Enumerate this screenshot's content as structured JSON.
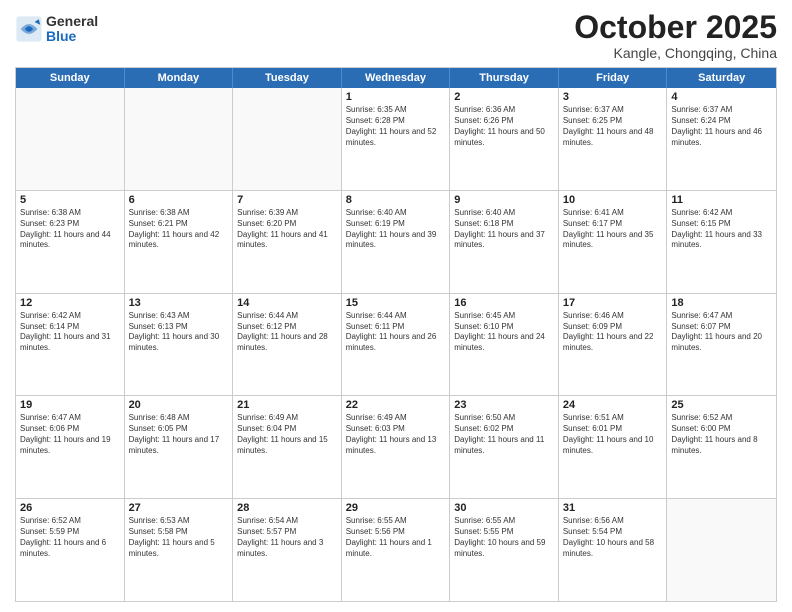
{
  "header": {
    "logo": {
      "general": "General",
      "blue": "Blue"
    },
    "title": "October 2025",
    "subtitle": "Kangle, Chongqing, China"
  },
  "days_of_week": [
    "Sunday",
    "Monday",
    "Tuesday",
    "Wednesday",
    "Thursday",
    "Friday",
    "Saturday"
  ],
  "rows": [
    [
      {
        "day": "",
        "empty": true
      },
      {
        "day": "",
        "empty": true
      },
      {
        "day": "",
        "empty": true
      },
      {
        "day": "1",
        "sunrise": "6:35 AM",
        "sunset": "6:28 PM",
        "daylight": "11 hours and 52 minutes."
      },
      {
        "day": "2",
        "sunrise": "6:36 AM",
        "sunset": "6:26 PM",
        "daylight": "11 hours and 50 minutes."
      },
      {
        "day": "3",
        "sunrise": "6:37 AM",
        "sunset": "6:25 PM",
        "daylight": "11 hours and 48 minutes."
      },
      {
        "day": "4",
        "sunrise": "6:37 AM",
        "sunset": "6:24 PM",
        "daylight": "11 hours and 46 minutes."
      }
    ],
    [
      {
        "day": "5",
        "sunrise": "6:38 AM",
        "sunset": "6:23 PM",
        "daylight": "11 hours and 44 minutes."
      },
      {
        "day": "6",
        "sunrise": "6:38 AM",
        "sunset": "6:21 PM",
        "daylight": "11 hours and 42 minutes."
      },
      {
        "day": "7",
        "sunrise": "6:39 AM",
        "sunset": "6:20 PM",
        "daylight": "11 hours and 41 minutes."
      },
      {
        "day": "8",
        "sunrise": "6:40 AM",
        "sunset": "6:19 PM",
        "daylight": "11 hours and 39 minutes."
      },
      {
        "day": "9",
        "sunrise": "6:40 AM",
        "sunset": "6:18 PM",
        "daylight": "11 hours and 37 minutes."
      },
      {
        "day": "10",
        "sunrise": "6:41 AM",
        "sunset": "6:17 PM",
        "daylight": "11 hours and 35 minutes."
      },
      {
        "day": "11",
        "sunrise": "6:42 AM",
        "sunset": "6:15 PM",
        "daylight": "11 hours and 33 minutes."
      }
    ],
    [
      {
        "day": "12",
        "sunrise": "6:42 AM",
        "sunset": "6:14 PM",
        "daylight": "11 hours and 31 minutes."
      },
      {
        "day": "13",
        "sunrise": "6:43 AM",
        "sunset": "6:13 PM",
        "daylight": "11 hours and 30 minutes."
      },
      {
        "day": "14",
        "sunrise": "6:44 AM",
        "sunset": "6:12 PM",
        "daylight": "11 hours and 28 minutes."
      },
      {
        "day": "15",
        "sunrise": "6:44 AM",
        "sunset": "6:11 PM",
        "daylight": "11 hours and 26 minutes."
      },
      {
        "day": "16",
        "sunrise": "6:45 AM",
        "sunset": "6:10 PM",
        "daylight": "11 hours and 24 minutes."
      },
      {
        "day": "17",
        "sunrise": "6:46 AM",
        "sunset": "6:09 PM",
        "daylight": "11 hours and 22 minutes."
      },
      {
        "day": "18",
        "sunrise": "6:47 AM",
        "sunset": "6:07 PM",
        "daylight": "11 hours and 20 minutes."
      }
    ],
    [
      {
        "day": "19",
        "sunrise": "6:47 AM",
        "sunset": "6:06 PM",
        "daylight": "11 hours and 19 minutes."
      },
      {
        "day": "20",
        "sunrise": "6:48 AM",
        "sunset": "6:05 PM",
        "daylight": "11 hours and 17 minutes."
      },
      {
        "day": "21",
        "sunrise": "6:49 AM",
        "sunset": "6:04 PM",
        "daylight": "11 hours and 15 minutes."
      },
      {
        "day": "22",
        "sunrise": "6:49 AM",
        "sunset": "6:03 PM",
        "daylight": "11 hours and 13 minutes."
      },
      {
        "day": "23",
        "sunrise": "6:50 AM",
        "sunset": "6:02 PM",
        "daylight": "11 hours and 11 minutes."
      },
      {
        "day": "24",
        "sunrise": "6:51 AM",
        "sunset": "6:01 PM",
        "daylight": "11 hours and 10 minutes."
      },
      {
        "day": "25",
        "sunrise": "6:52 AM",
        "sunset": "6:00 PM",
        "daylight": "11 hours and 8 minutes."
      }
    ],
    [
      {
        "day": "26",
        "sunrise": "6:52 AM",
        "sunset": "5:59 PM",
        "daylight": "11 hours and 6 minutes."
      },
      {
        "day": "27",
        "sunrise": "6:53 AM",
        "sunset": "5:58 PM",
        "daylight": "11 hours and 5 minutes."
      },
      {
        "day": "28",
        "sunrise": "6:54 AM",
        "sunset": "5:57 PM",
        "daylight": "11 hours and 3 minutes."
      },
      {
        "day": "29",
        "sunrise": "6:55 AM",
        "sunset": "5:56 PM",
        "daylight": "11 hours and 1 minute."
      },
      {
        "day": "30",
        "sunrise": "6:55 AM",
        "sunset": "5:55 PM",
        "daylight": "10 hours and 59 minutes."
      },
      {
        "day": "31",
        "sunrise": "6:56 AM",
        "sunset": "5:54 PM",
        "daylight": "10 hours and 58 minutes."
      },
      {
        "day": "",
        "empty": true
      }
    ]
  ]
}
